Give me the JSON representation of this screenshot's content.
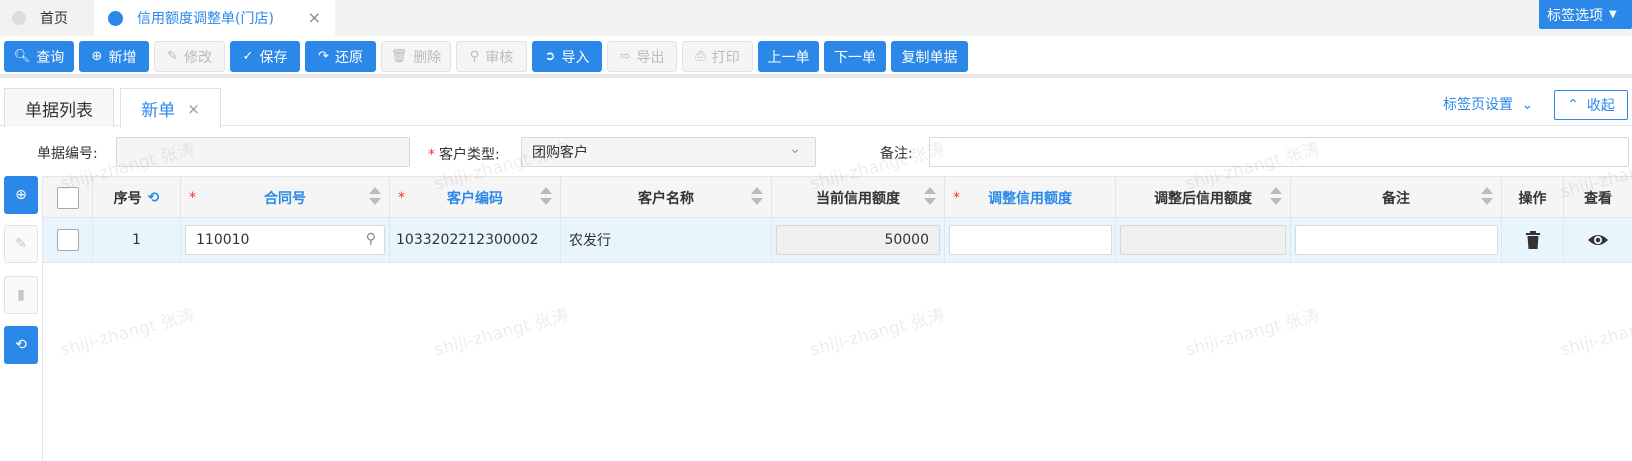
{
  "top_tabs": [
    {
      "label": "首页"
    },
    {
      "label": "信用额度调整单(门店)",
      "close": "×"
    }
  ],
  "tag_options": {
    "label": "标签选项"
  },
  "toolbar": {
    "query": "查询",
    "add": "新增",
    "edit": "修改",
    "save": "保存",
    "restore": "还原",
    "delete": "删除",
    "audit": "审核",
    "import": "导入",
    "export": "导出",
    "print": "打印",
    "prev": "上一单",
    "next": "下一单",
    "copy": "复制单据"
  },
  "sub_tabs": {
    "list": "单据列表",
    "new": "新单",
    "close": "×"
  },
  "tab_settings": "标签页设置",
  "collapse": "收起",
  "form": {
    "doc_no_label": "单据编号:",
    "doc_no_value": "",
    "customer_type_label": "客户类型:",
    "customer_type_value": "团购客户",
    "remark_label": "备注:",
    "remark_value": ""
  },
  "grid": {
    "headers": {
      "seq": "序号",
      "contract": "合同号",
      "cust_code": "客户编码",
      "cust_name": "客户名称",
      "current_credit": "当前信用额度",
      "adjust_credit": "调整信用额度",
      "after_credit": "调整后信用额度",
      "remark": "备注",
      "action": "操作",
      "view": "查看"
    },
    "rows": [
      {
        "seq": "1",
        "contract": "110010",
        "cust_code": "1033202212300002",
        "cust_name": "农发行",
        "current_credit": "50000",
        "adjust_credit": "",
        "after_credit": "",
        "remark": ""
      }
    ]
  },
  "watermark": "shiji-zhangt 张涛",
  "colors": {
    "accent": "#2b88e8",
    "required": "#e33333",
    "row_selected": "#e8f5fc"
  }
}
